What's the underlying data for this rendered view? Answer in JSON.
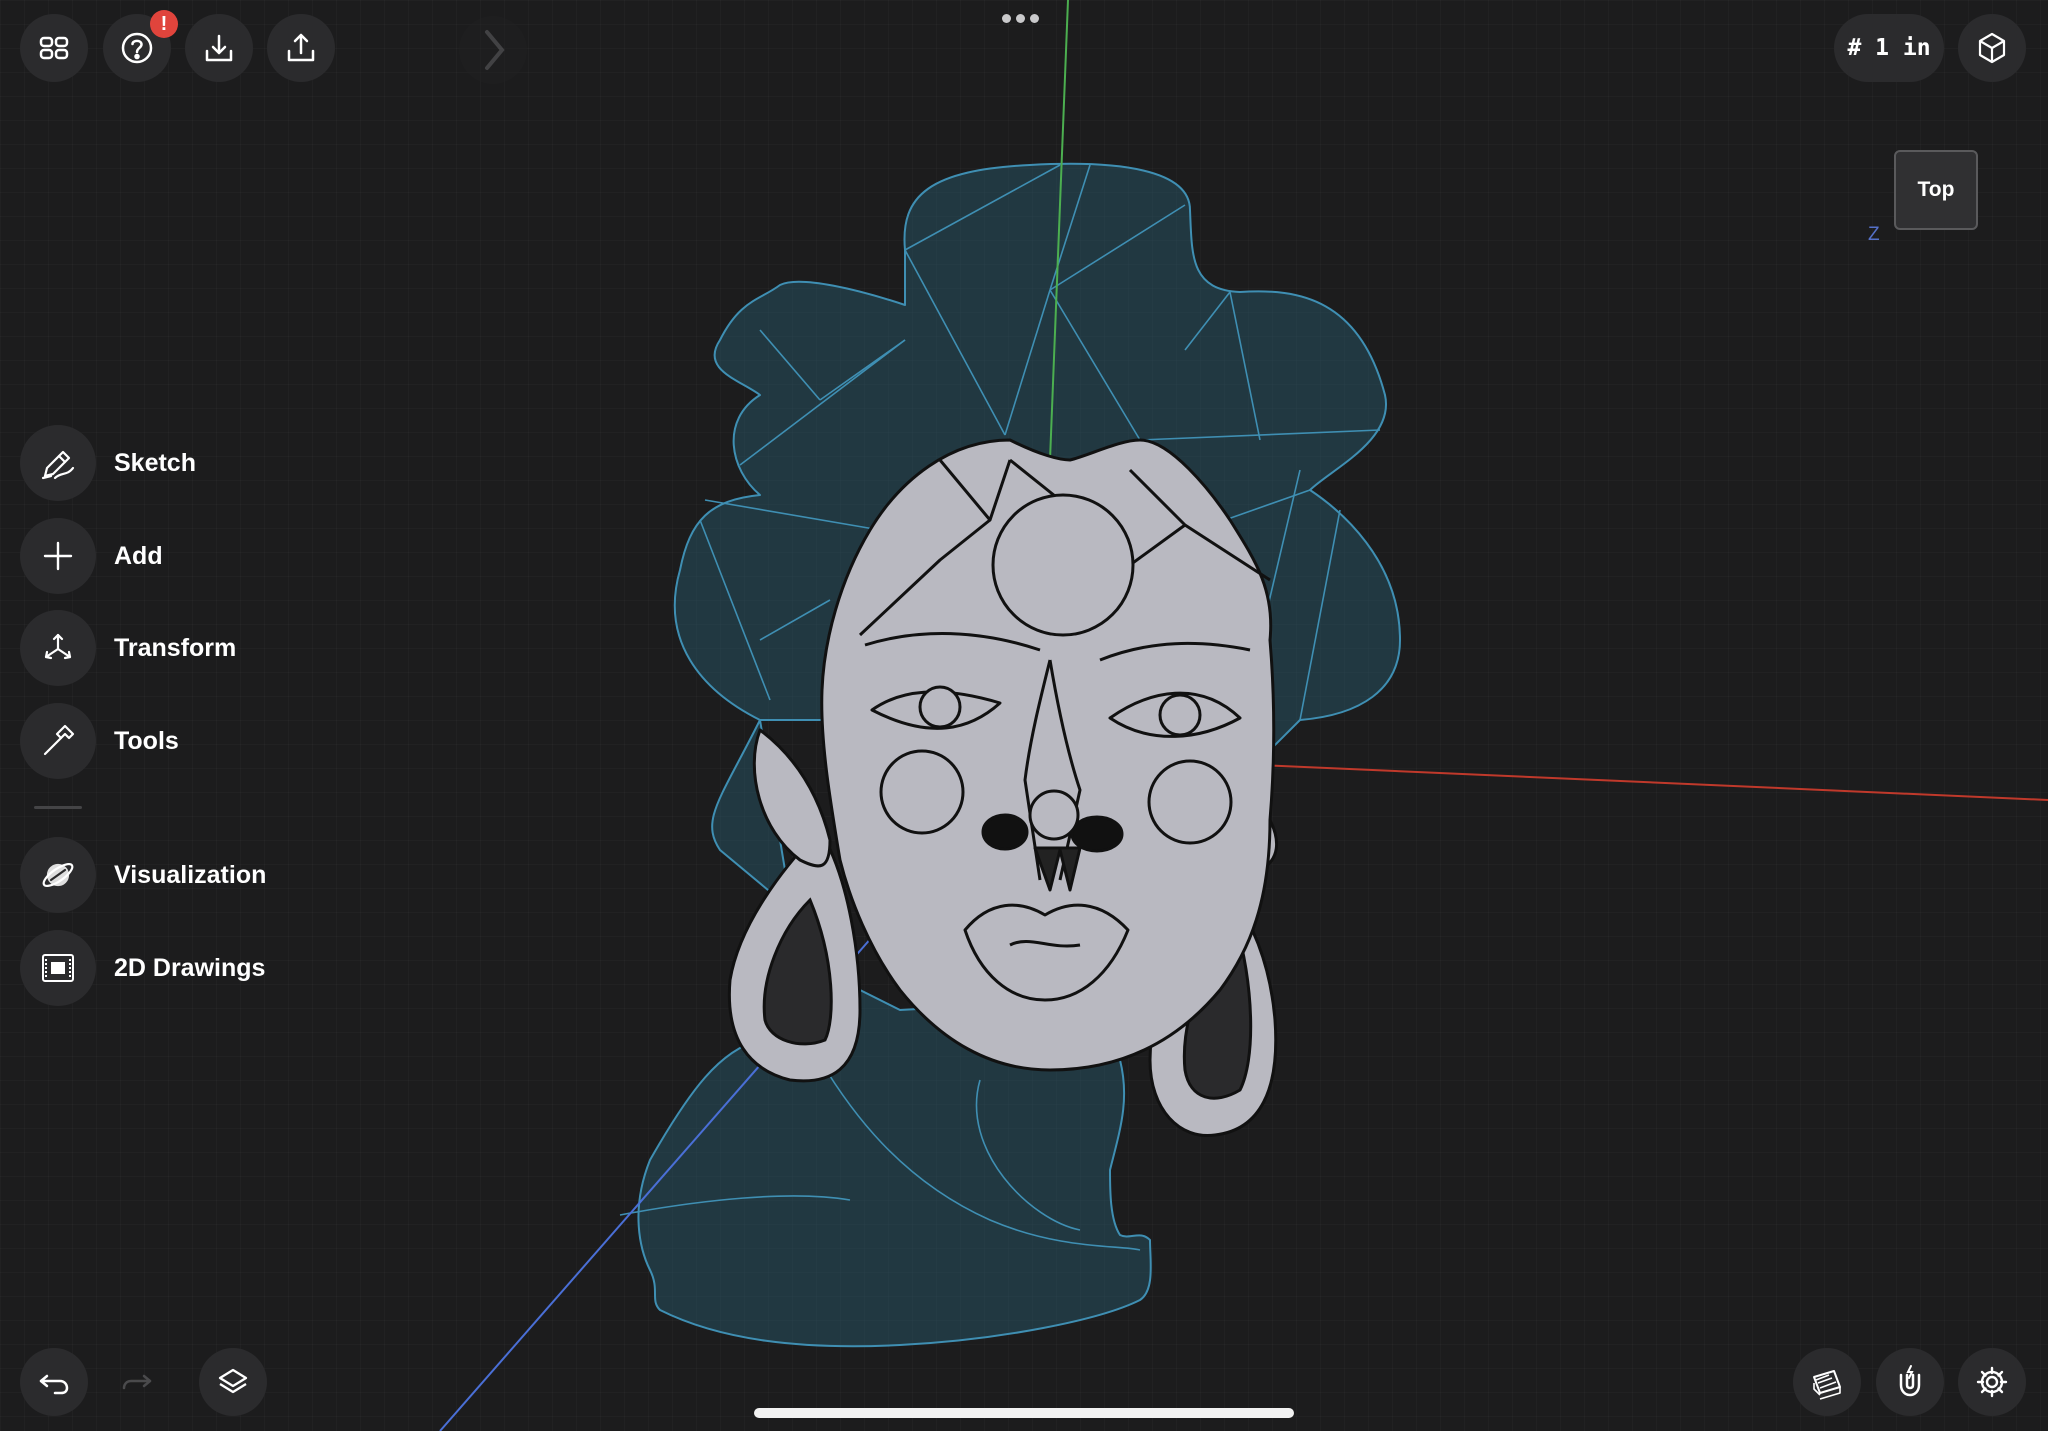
{
  "toolbar": {
    "alert_badge": "!",
    "units_label": "# 1 in"
  },
  "viewcube": {
    "face_label": "Top",
    "axis_label": "Z"
  },
  "side_menu": {
    "items": [
      {
        "label": "Sketch",
        "icon": "pen-icon"
      },
      {
        "label": "Add",
        "icon": "plus-icon"
      },
      {
        "label": "Transform",
        "icon": "transform-arrows-icon"
      },
      {
        "label": "Tools",
        "icon": "hammer-icon"
      },
      {
        "label": "Visualization",
        "icon": "visualization-icon"
      },
      {
        "label": "2D Drawings",
        "icon": "drawings-icon"
      }
    ]
  },
  "colors": {
    "background": "#1c1c1d",
    "button": "#2b2b2d",
    "wireframe": "#3f8fb3",
    "face_fill": "#b9b9c1",
    "axis_x": "#c0392b",
    "axis_y": "#4caf50",
    "axis_z": "#4a6fd6",
    "badge": "#e0443c"
  }
}
